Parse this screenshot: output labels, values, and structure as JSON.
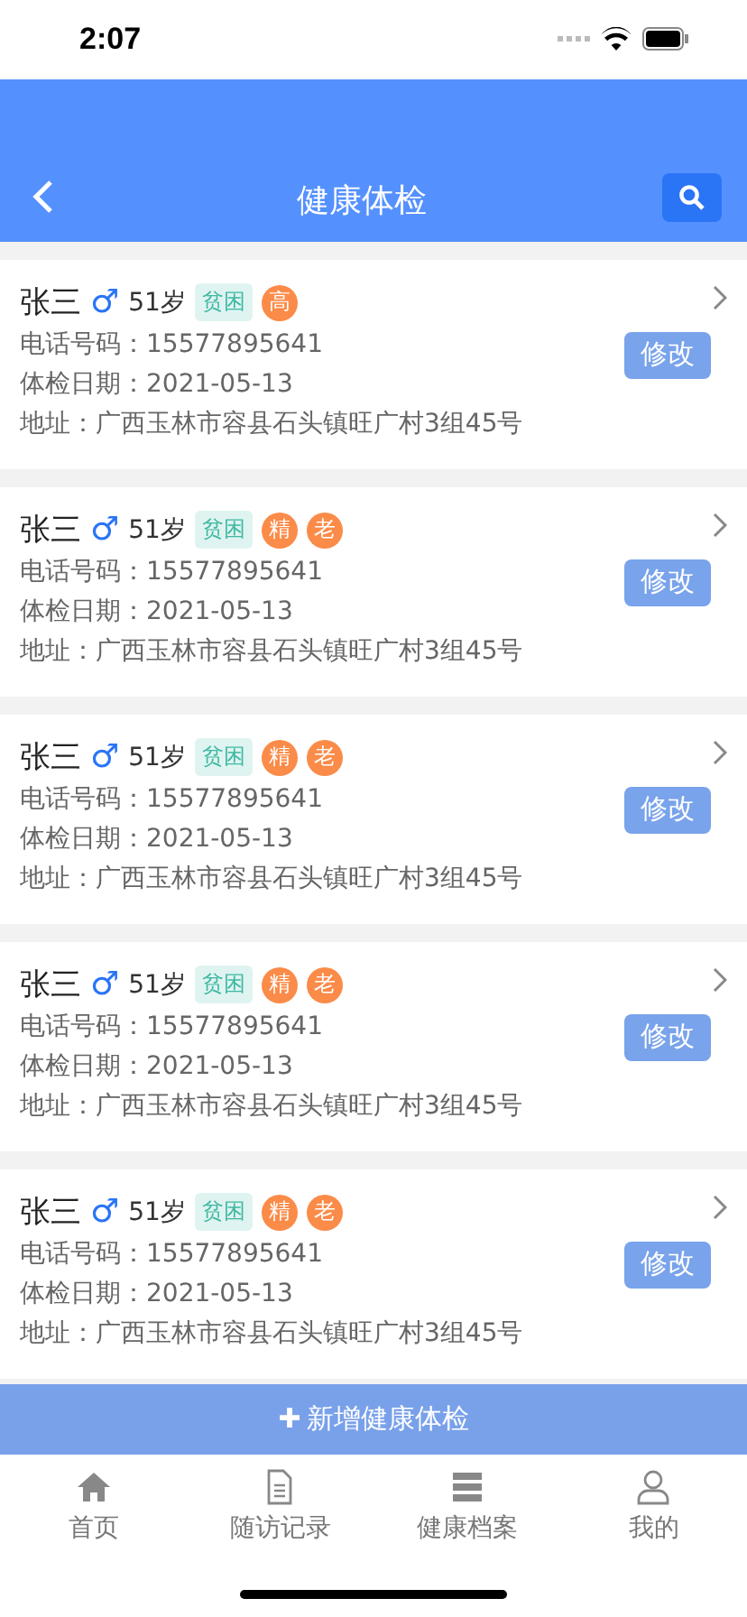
{
  "status_bar": {
    "time": "2:07"
  },
  "header": {
    "title": "健康体检"
  },
  "records": [
    {
      "name": "张三",
      "gender": "♂",
      "age": "51岁",
      "tags": [
        {
          "text": "贫困",
          "kind": "label"
        },
        {
          "text": "高",
          "kind": "circle"
        }
      ],
      "phone_label": "电话号码：",
      "phone": "15577895641",
      "date_label": "体检日期：",
      "date": "2021-05-13",
      "address_label": "地址：",
      "address": "广西玉林市容县石头镇旺广村3组45号",
      "button": "修改"
    },
    {
      "name": "张三",
      "gender": "♂",
      "age": "51岁",
      "tags": [
        {
          "text": "贫困",
          "kind": "label"
        },
        {
          "text": "精",
          "kind": "circle"
        },
        {
          "text": "老",
          "kind": "circle"
        }
      ],
      "phone_label": "电话号码：",
      "phone": "15577895641",
      "date_label": "体检日期：",
      "date": "2021-05-13",
      "address_label": "地址：",
      "address": "广西玉林市容县石头镇旺广村3组45号",
      "button": "修改"
    },
    {
      "name": "张三",
      "gender": "♂",
      "age": "51岁",
      "tags": [
        {
          "text": "贫困",
          "kind": "label"
        },
        {
          "text": "精",
          "kind": "circle"
        },
        {
          "text": "老",
          "kind": "circle"
        }
      ],
      "phone_label": "电话号码：",
      "phone": "15577895641",
      "date_label": "体检日期：",
      "date": "2021-05-13",
      "address_label": "地址：",
      "address": "广西玉林市容县石头镇旺广村3组45号",
      "button": "修改"
    },
    {
      "name": "张三",
      "gender": "♂",
      "age": "51岁",
      "tags": [
        {
          "text": "贫困",
          "kind": "label"
        },
        {
          "text": "精",
          "kind": "circle"
        },
        {
          "text": "老",
          "kind": "circle"
        }
      ],
      "phone_label": "电话号码：",
      "phone": "15577895641",
      "date_label": "体检日期：",
      "date": "2021-05-13",
      "address_label": "地址：",
      "address": "广西玉林市容县石头镇旺广村3组45号",
      "button": "修改"
    },
    {
      "name": "张三",
      "gender": "♂",
      "age": "51岁",
      "tags": [
        {
          "text": "贫困",
          "kind": "label"
        },
        {
          "text": "精",
          "kind": "circle"
        },
        {
          "text": "老",
          "kind": "circle"
        }
      ],
      "phone_label": "电话号码：",
      "phone": "15577895641",
      "date_label": "体检日期：",
      "date": "2021-05-13",
      "address_label": "地址：",
      "address": "广西玉林市容县石头镇旺广村3组45号",
      "button": "修改"
    }
  ],
  "add_button": {
    "icon": "✚",
    "label": "新增健康体检"
  },
  "tab_bar": [
    {
      "label": "首页"
    },
    {
      "label": "随访记录"
    },
    {
      "label": "健康档案"
    },
    {
      "label": "我的"
    }
  ]
}
